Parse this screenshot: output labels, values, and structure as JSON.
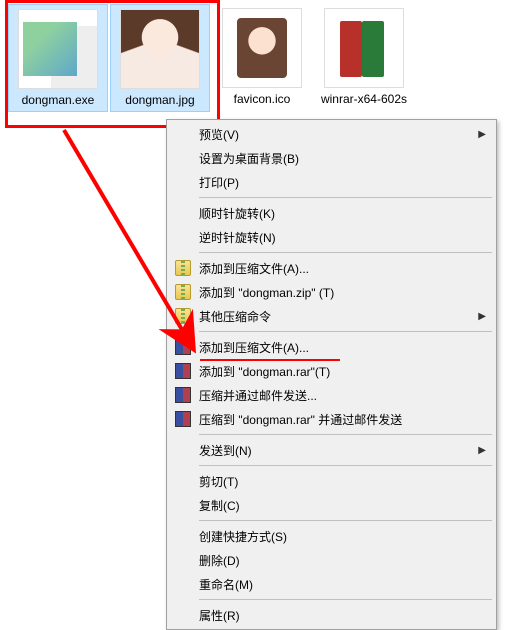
{
  "files": [
    {
      "label": "dongman.exe",
      "selected": true,
      "thumb": "exe"
    },
    {
      "label": "dongman.jpg",
      "selected": true,
      "thumb": "anime"
    },
    {
      "label": "favicon.ico",
      "selected": false,
      "thumb": "ico"
    },
    {
      "label": "winrar-x64-602s",
      "selected": false,
      "thumb": "rar"
    }
  ],
  "menu": {
    "items": [
      {
        "type": "item",
        "label": "预览(V)",
        "submenu": true
      },
      {
        "type": "item",
        "label": "设置为桌面背景(B)"
      },
      {
        "type": "item",
        "label": "打印(P)"
      },
      {
        "type": "sep"
      },
      {
        "type": "item",
        "label": "顺时针旋转(K)"
      },
      {
        "type": "item",
        "label": "逆时针旋转(N)"
      },
      {
        "type": "sep"
      },
      {
        "type": "item",
        "label": "添加到压缩文件(A)...",
        "icon": "zip"
      },
      {
        "type": "item",
        "label": "添加到 \"dongman.zip\" (T)",
        "icon": "zip"
      },
      {
        "type": "item",
        "label": "其他压缩命令",
        "icon": "zip",
        "submenu": true
      },
      {
        "type": "sep"
      },
      {
        "type": "item",
        "label": "添加到压缩文件(A)...",
        "icon": "rar",
        "highlighted": true
      },
      {
        "type": "item",
        "label": "添加到 \"dongman.rar\"(T)",
        "icon": "rar"
      },
      {
        "type": "item",
        "label": "压缩并通过邮件发送...",
        "icon": "rar"
      },
      {
        "type": "item",
        "label": "压缩到 \"dongman.rar\" 并通过邮件发送",
        "icon": "rar"
      },
      {
        "type": "sep"
      },
      {
        "type": "item",
        "label": "发送到(N)",
        "submenu": true
      },
      {
        "type": "sep"
      },
      {
        "type": "item",
        "label": "剪切(T)"
      },
      {
        "type": "item",
        "label": "复制(C)"
      },
      {
        "type": "sep"
      },
      {
        "type": "item",
        "label": "创建快捷方式(S)"
      },
      {
        "type": "item",
        "label": "删除(D)"
      },
      {
        "type": "item",
        "label": "重命名(M)"
      },
      {
        "type": "sep"
      },
      {
        "type": "item",
        "label": "属性(R)"
      }
    ]
  }
}
